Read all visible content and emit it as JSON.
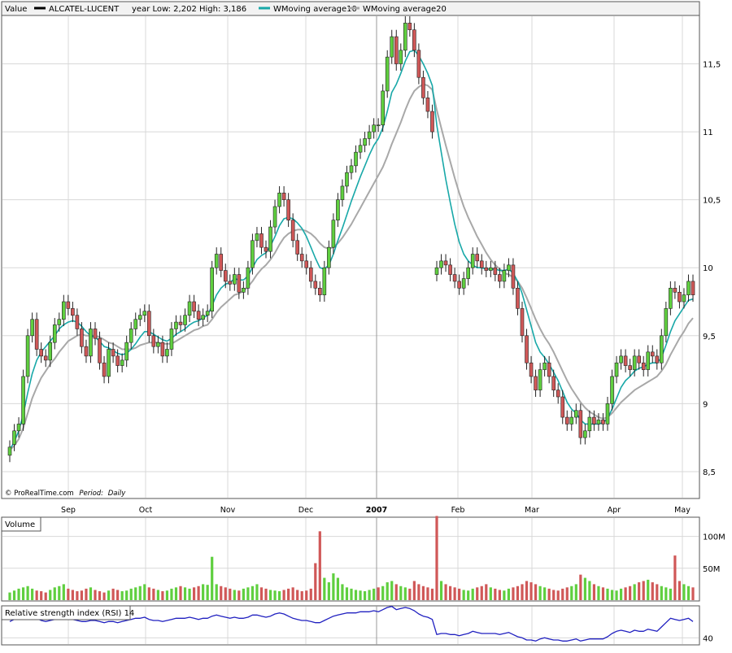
{
  "header": {
    "value_label": "Value",
    "ticker": "ALCATEL-LUCENT",
    "year_range": "year Low: 2,202 High: 3,186",
    "ma10_label": "WMoving average10",
    "ma20_label": "WMoving average20"
  },
  "footer": {
    "credit": "© ProRealTime.com",
    "period_label": "Period:",
    "period_value": "Daily"
  },
  "panels": {
    "volume_label": "Volume",
    "rsi_label": "Relative strength index (RSI) 14"
  },
  "colors": {
    "up": "#5fcf3f",
    "down": "#d05858",
    "ma10": "#18a8a8",
    "ma20": "#a8a8a8",
    "rsi": "#2020c0",
    "grid": "#d8d8d8"
  },
  "chart_data": [
    {
      "type": "candlestick",
      "x_tick_labels": [
        "Sep",
        "Oct",
        "Nov",
        "Dec",
        "2007",
        "Feb",
        "Mar",
        "Apr",
        "May"
      ],
      "y_ticks": [
        8.5,
        9,
        9.5,
        10,
        10.5,
        11,
        11.5
      ],
      "y_tick_labels": [
        "8,5",
        "9",
        "9,5",
        "10",
        "10,5",
        "11",
        "11,5"
      ],
      "ylim": [
        8.38,
        11.85
      ],
      "series_names": [
        "WMoving average10",
        "WMoving average20"
      ],
      "grid": true,
      "close": [
        8.68,
        8.8,
        8.85,
        9.2,
        9.5,
        9.62,
        9.4,
        9.35,
        9.32,
        9.45,
        9.58,
        9.62,
        9.75,
        9.7,
        9.65,
        9.55,
        9.42,
        9.35,
        9.55,
        9.48,
        9.3,
        9.2,
        9.4,
        9.35,
        9.28,
        9.32,
        9.45,
        9.55,
        9.62,
        9.65,
        9.68,
        9.5,
        9.42,
        9.45,
        9.35,
        9.4,
        9.55,
        9.6,
        9.58,
        9.65,
        9.75,
        9.68,
        9.62,
        9.65,
        9.68,
        10.0,
        10.1,
        9.98,
        9.9,
        9.88,
        9.95,
        9.82,
        9.85,
        10.0,
        10.2,
        10.25,
        10.15,
        10.12,
        10.3,
        10.45,
        10.55,
        10.5,
        10.35,
        10.2,
        10.1,
        10.05,
        10.0,
        9.9,
        9.85,
        9.8,
        10.0,
        10.15,
        10.35,
        10.5,
        10.6,
        10.7,
        10.75,
        10.85,
        10.9,
        10.95,
        11.0,
        11.05,
        11.05,
        11.3,
        11.55,
        11.7,
        11.5,
        11.6,
        11.8,
        11.75,
        11.6,
        11.4,
        11.25,
        11.15,
        11.0,
        10.0,
        10.05,
        10.02,
        9.95,
        9.9,
        9.85,
        9.92,
        10.0,
        10.1,
        10.05,
        10.0,
        9.98,
        10.0,
        9.95,
        9.9,
        9.98,
        10.02,
        9.85,
        9.7,
        9.5,
        9.3,
        9.2,
        9.1,
        9.25,
        9.3,
        9.2,
        9.1,
        9.05,
        8.9,
        8.85,
        8.9,
        8.95,
        8.75,
        8.8,
        8.9,
        8.85,
        8.88,
        8.85,
        9.0,
        9.2,
        9.3,
        9.35,
        9.28,
        9.25,
        9.35,
        9.3,
        9.25,
        9.38,
        9.35,
        9.3,
        9.5,
        9.7,
        9.85,
        9.82,
        9.75,
        9.8,
        9.9,
        9.8
      ],
      "open": [
        8.62,
        8.7,
        8.8,
        8.85,
        9.2,
        9.5,
        9.62,
        9.4,
        9.35,
        9.32,
        9.45,
        9.58,
        9.62,
        9.75,
        9.7,
        9.65,
        9.55,
        9.42,
        9.35,
        9.55,
        9.48,
        9.3,
        9.2,
        9.4,
        9.35,
        9.28,
        9.32,
        9.45,
        9.55,
        9.62,
        9.65,
        9.68,
        9.5,
        9.42,
        9.45,
        9.35,
        9.4,
        9.55,
        9.6,
        9.58,
        9.65,
        9.75,
        9.68,
        9.62,
        9.65,
        9.68,
        10.0,
        10.1,
        9.98,
        9.9,
        9.88,
        9.95,
        9.82,
        9.85,
        10.0,
        10.2,
        10.25,
        10.15,
        10.12,
        10.3,
        10.45,
        10.55,
        10.5,
        10.35,
        10.2,
        10.1,
        10.05,
        10.0,
        9.9,
        9.85,
        9.8,
        10.0,
        10.15,
        10.35,
        10.5,
        10.6,
        10.7,
        10.75,
        10.85,
        10.9,
        10.95,
        11.0,
        11.05,
        11.05,
        11.3,
        11.55,
        11.7,
        11.5,
        11.6,
        11.8,
        11.75,
        11.6,
        11.4,
        11.25,
        11.15,
        9.95,
        10.0,
        10.05,
        10.02,
        9.95,
        9.9,
        9.85,
        9.92,
        10.0,
        10.1,
        10.05,
        10.0,
        9.98,
        10.0,
        9.95,
        9.9,
        9.98,
        10.02,
        9.85,
        9.7,
        9.5,
        9.3,
        9.2,
        9.1,
        9.25,
        9.3,
        9.2,
        9.1,
        9.05,
        8.9,
        8.85,
        8.9,
        8.95,
        8.75,
        8.8,
        8.9,
        8.85,
        8.88,
        8.85,
        9.0,
        9.2,
        9.3,
        9.35,
        9.28,
        9.25,
        9.35,
        9.3,
        9.25,
        9.38,
        9.35,
        9.3,
        9.5,
        9.7,
        9.85,
        9.82,
        9.75,
        9.8,
        9.9
      ],
      "ma10": [
        8.66,
        8.72,
        8.8,
        8.92,
        9.08,
        9.22,
        9.32,
        9.38,
        9.42,
        9.46,
        9.5,
        9.55,
        9.58,
        9.6,
        9.61,
        9.6,
        9.57,
        9.53,
        9.5,
        9.49,
        9.46,
        9.42,
        9.41,
        9.39,
        9.37,
        9.36,
        9.37,
        9.4,
        9.44,
        9.49,
        9.53,
        9.53,
        9.51,
        9.49,
        9.47,
        9.46,
        9.48,
        9.51,
        9.53,
        9.55,
        9.58,
        9.6,
        9.61,
        9.63,
        9.65,
        9.72,
        9.8,
        9.85,
        9.88,
        9.89,
        9.92,
        9.91,
        9.91,
        9.94,
        10.0,
        10.06,
        10.09,
        10.11,
        10.16,
        10.23,
        10.31,
        10.36,
        10.37,
        10.36,
        10.33,
        10.29,
        10.23,
        10.15,
        10.07,
        10.0,
        9.99,
        10.02,
        10.1,
        10.2,
        10.29,
        10.39,
        10.49,
        10.58,
        10.67,
        10.75,
        10.83,
        10.9,
        10.95,
        11.03,
        11.15,
        11.29,
        11.35,
        11.43,
        11.52,
        11.59,
        11.6,
        11.56,
        11.5,
        11.43,
        11.34,
        11.05,
        10.85,
        10.65,
        10.48,
        10.32,
        10.19,
        10.1,
        10.05,
        10.02,
        10.0,
        10.0,
        9.99,
        9.99,
        9.99,
        9.98,
        9.98,
        9.99,
        9.96,
        9.9,
        9.81,
        9.69,
        9.57,
        9.45,
        9.38,
        9.34,
        9.29,
        9.23,
        9.17,
        9.09,
        9.01,
        8.96,
        8.93,
        8.88,
        8.85,
        8.85,
        8.85,
        8.85,
        8.86,
        8.89,
        8.96,
        9.04,
        9.12,
        9.17,
        9.2,
        9.24,
        9.26,
        9.27,
        9.29,
        9.3,
        9.3,
        9.34,
        9.43,
        9.53,
        9.61,
        9.66,
        9.71,
        9.76,
        9.77
      ],
      "ma20": [
        8.66,
        8.69,
        8.74,
        8.82,
        8.93,
        9.04,
        9.12,
        9.19,
        9.24,
        9.29,
        9.33,
        9.38,
        9.42,
        9.46,
        9.48,
        9.5,
        9.51,
        9.5,
        9.5,
        9.5,
        9.49,
        9.47,
        9.45,
        9.44,
        9.42,
        9.4,
        9.4,
        9.4,
        9.41,
        9.43,
        9.44,
        9.45,
        9.45,
        9.45,
        9.44,
        9.44,
        9.44,
        9.46,
        9.48,
        9.5,
        9.52,
        9.54,
        9.55,
        9.57,
        9.58,
        9.62,
        9.67,
        9.71,
        9.74,
        9.77,
        9.8,
        9.81,
        9.83,
        9.86,
        9.9,
        9.95,
        9.99,
        10.02,
        10.06,
        10.11,
        10.17,
        10.22,
        10.25,
        10.27,
        10.28,
        10.28,
        10.27,
        10.25,
        10.22,
        10.18,
        10.15,
        10.14,
        10.15,
        10.18,
        10.22,
        10.27,
        10.32,
        10.38,
        10.44,
        10.5,
        10.56,
        10.62,
        10.68,
        10.74,
        10.82,
        10.91,
        10.99,
        11.07,
        11.16,
        11.24,
        11.3,
        11.33,
        11.35,
        11.34,
        11.31,
        11.16,
        11.03,
        10.9,
        10.78,
        10.66,
        10.55,
        10.45,
        10.37,
        10.3,
        10.23,
        10.17,
        10.11,
        10.06,
        10.02,
        9.99,
        9.96,
        9.95,
        9.93,
        9.9,
        9.85,
        9.78,
        9.7,
        9.62,
        9.55,
        9.49,
        9.44,
        9.38,
        9.31,
        9.24,
        9.17,
        9.11,
        9.06,
        9.01,
        8.97,
        8.94,
        8.92,
        8.9,
        8.89,
        8.9,
        8.93,
        8.97,
        9.01,
        9.04,
        9.07,
        9.1,
        9.12,
        9.14,
        9.16,
        9.18,
        9.2,
        9.24,
        9.29,
        9.36,
        9.42,
        9.48,
        9.53,
        9.59,
        9.63
      ]
    },
    {
      "type": "bar",
      "name": "Volume",
      "y_ticks": [
        50,
        100
      ],
      "y_tick_labels": [
        "50M",
        "100M"
      ],
      "ylim": [
        0,
        125
      ],
      "values": [
        12,
        15,
        18,
        20,
        22,
        18,
        15,
        14,
        12,
        16,
        20,
        22,
        25,
        18,
        16,
        14,
        15,
        18,
        20,
        16,
        14,
        12,
        15,
        18,
        16,
        14,
        15,
        18,
        20,
        22,
        25,
        20,
        18,
        16,
        14,
        15,
        18,
        20,
        22,
        20,
        18,
        20,
        22,
        25,
        24,
        68,
        25,
        22,
        20,
        18,
        16,
        15,
        18,
        20,
        22,
        25,
        20,
        18,
        16,
        15,
        14,
        16,
        18,
        20,
        16,
        14,
        15,
        18,
        58,
        108,
        35,
        28,
        42,
        35,
        25,
        20,
        18,
        16,
        15,
        14,
        16,
        18,
        20,
        22,
        28,
        30,
        25,
        22,
        20,
        18,
        30,
        25,
        22,
        20,
        18,
        132,
        30,
        25,
        22,
        20,
        18,
        16,
        15,
        18,
        20,
        22,
        25,
        20,
        18,
        16,
        15,
        18,
        20,
        22,
        25,
        30,
        28,
        25,
        22,
        20,
        18,
        16,
        15,
        18,
        20,
        22,
        25,
        40,
        35,
        30,
        25,
        22,
        20,
        18,
        16,
        15,
        18,
        20,
        22,
        25,
        28,
        30,
        32,
        28,
        25,
        22,
        20,
        18,
        70,
        30,
        25,
        22,
        20
      ],
      "up": [
        1,
        1,
        1,
        1,
        1,
        1,
        0,
        0,
        0,
        1,
        1,
        1,
        1,
        0,
        0,
        0,
        0,
        0,
        1,
        0,
        0,
        0,
        1,
        0,
        0,
        1,
        1,
        1,
        1,
        1,
        1,
        0,
        0,
        1,
        0,
        1,
        1,
        1,
        0,
        1,
        1,
        0,
        0,
        1,
        1,
        1,
        1,
        0,
        0,
        0,
        1,
        0,
        1,
        1,
        1,
        1,
        0,
        0,
        1,
        1,
        1,
        0,
        0,
        0,
        0,
        0,
        0,
        0,
        0,
        0,
        1,
        1,
        1,
        1,
        1,
        1,
        1,
        1,
        1,
        1,
        1,
        1,
        0,
        1,
        1,
        1,
        0,
        1,
        1,
        0,
        0,
        0,
        0,
        0,
        0,
        0,
        1,
        0,
        0,
        0,
        0,
        1,
        1,
        1,
        0,
        0,
        0,
        1,
        0,
        0,
        1,
        1,
        0,
        0,
        0,
        0,
        0,
        0,
        1,
        1,
        0,
        0,
        0,
        0,
        0,
        1,
        1,
        0,
        1,
        1,
        0,
        1,
        0,
        1,
        1,
        1,
        1,
        0,
        0,
        1,
        0,
        0,
        1,
        0,
        0,
        1,
        1,
        1,
        0,
        0,
        1,
        1,
        0
      ]
    },
    {
      "type": "line",
      "name": "Relative strength index (RSI) 14",
      "y_ticks": [
        40
      ],
      "y_tick_labels": [
        "40"
      ],
      "ylim": [
        35,
        68
      ],
      "values": [
        55,
        57,
        59,
        60,
        60,
        59,
        58,
        56,
        55,
        56,
        57,
        58,
        59,
        58,
        57,
        56,
        55,
        55,
        56,
        56,
        55,
        54,
        55,
        55,
        54,
        55,
        56,
        57,
        58,
        58,
        59,
        57,
        56,
        56,
        55,
        56,
        57,
        58,
        58,
        58,
        59,
        58,
        57,
        58,
        58,
        60,
        61,
        60,
        59,
        58,
        59,
        58,
        58,
        59,
        61,
        61,
        60,
        59,
        60,
        62,
        63,
        62,
        60,
        58,
        57,
        56,
        56,
        55,
        54,
        54,
        56,
        58,
        60,
        61,
        62,
        63,
        63,
        63,
        64,
        64,
        64,
        65,
        64,
        66,
        68,
        69,
        66,
        67,
        68,
        67,
        65,
        62,
        60,
        59,
        57,
        43,
        44,
        44,
        43,
        43,
        42,
        43,
        44,
        46,
        45,
        44,
        44,
        44,
        44,
        43,
        44,
        45,
        43,
        41,
        40,
        38,
        38,
        37,
        39,
        40,
        39,
        38,
        38,
        37,
        37,
        38,
        39,
        37,
        38,
        39,
        39,
        39,
        39,
        41,
        44,
        46,
        47,
        46,
        45,
        47,
        46,
        46,
        48,
        47,
        46,
        50,
        54,
        58,
        57,
        56,
        57,
        58,
        55
      ]
    }
  ]
}
